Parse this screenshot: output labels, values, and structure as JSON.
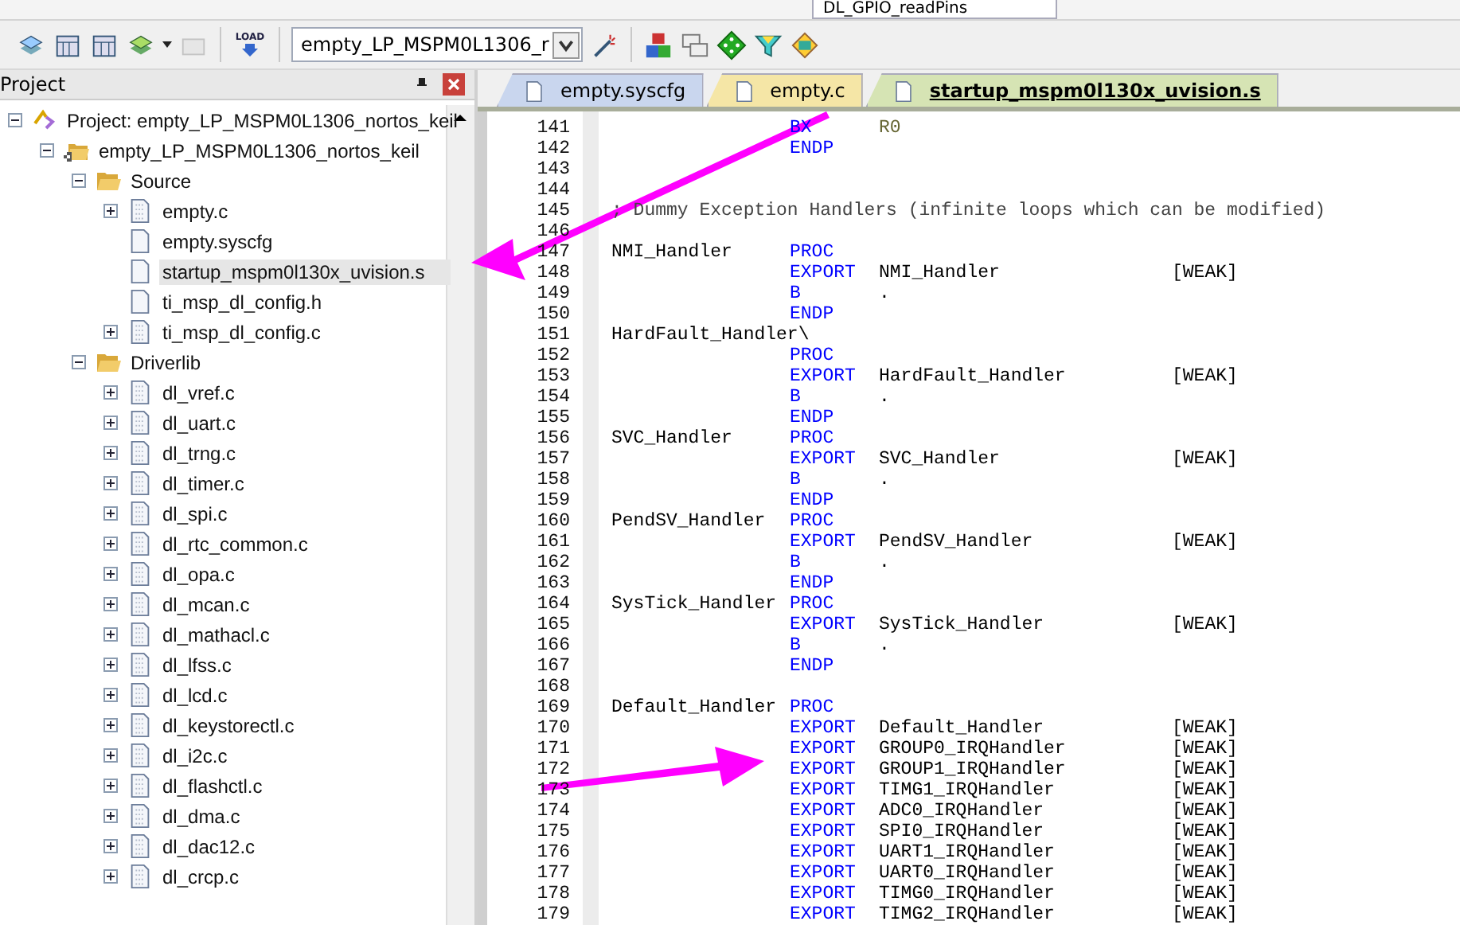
{
  "toolbar_top": {
    "function_dropdown": "DL_GPIO_readPins"
  },
  "toolbar": {
    "load_label": "LOAD",
    "target_dropdown": "empty_LP_MSPM0L1306_r"
  },
  "project_panel": {
    "title": "Project",
    "tree": [
      {
        "label": "Project: empty_LP_MSPM0L1306_nortos_keil",
        "kind": "project",
        "expanded": true,
        "selected": false,
        "children": [
          {
            "label": "empty_LP_MSPM0L1306_nortos_keil",
            "kind": "target",
            "expanded": true,
            "selected": false,
            "children": [
              {
                "label": "Source",
                "kind": "group",
                "expanded": true,
                "selected": false,
                "children": [
                  {
                    "label": "empty.c",
                    "kind": "file",
                    "expandable": true,
                    "selected": false
                  },
                  {
                    "label": "empty.syscfg",
                    "kind": "file",
                    "expandable": false,
                    "selected": false
                  },
                  {
                    "label": "startup_mspm0l130x_uvision.s",
                    "kind": "file",
                    "expandable": false,
                    "selected": true
                  },
                  {
                    "label": "ti_msp_dl_config.h",
                    "kind": "file",
                    "expandable": false,
                    "selected": false
                  },
                  {
                    "label": "ti_msp_dl_config.c",
                    "kind": "file",
                    "expandable": true,
                    "selected": false
                  }
                ]
              },
              {
                "label": "Driverlib",
                "kind": "group",
                "expanded": true,
                "selected": false,
                "children": [
                  {
                    "label": "dl_vref.c",
                    "kind": "file",
                    "expandable": true,
                    "selected": false
                  },
                  {
                    "label": "dl_uart.c",
                    "kind": "file",
                    "expandable": true,
                    "selected": false
                  },
                  {
                    "label": "dl_trng.c",
                    "kind": "file",
                    "expandable": true,
                    "selected": false
                  },
                  {
                    "label": "dl_timer.c",
                    "kind": "file",
                    "expandable": true,
                    "selected": false
                  },
                  {
                    "label": "dl_spi.c",
                    "kind": "file",
                    "expandable": true,
                    "selected": false
                  },
                  {
                    "label": "dl_rtc_common.c",
                    "kind": "file",
                    "expandable": true,
                    "selected": false
                  },
                  {
                    "label": "dl_opa.c",
                    "kind": "file",
                    "expandable": true,
                    "selected": false
                  },
                  {
                    "label": "dl_mcan.c",
                    "kind": "file",
                    "expandable": true,
                    "selected": false
                  },
                  {
                    "label": "dl_mathacl.c",
                    "kind": "file",
                    "expandable": true,
                    "selected": false
                  },
                  {
                    "label": "dl_lfss.c",
                    "kind": "file",
                    "expandable": true,
                    "selected": false
                  },
                  {
                    "label": "dl_lcd.c",
                    "kind": "file",
                    "expandable": true,
                    "selected": false
                  },
                  {
                    "label": "dl_keystorectl.c",
                    "kind": "file",
                    "expandable": true,
                    "selected": false
                  },
                  {
                    "label": "dl_i2c.c",
                    "kind": "file",
                    "expandable": true,
                    "selected": false
                  },
                  {
                    "label": "dl_flashctl.c",
                    "kind": "file",
                    "expandable": true,
                    "selected": false
                  },
                  {
                    "label": "dl_dma.c",
                    "kind": "file",
                    "expandable": true,
                    "selected": false
                  },
                  {
                    "label": "dl_dac12.c",
                    "kind": "file",
                    "expandable": true,
                    "selected": false
                  },
                  {
                    "label": "dl_crcp.c",
                    "kind": "file",
                    "expandable": true,
                    "selected": false
                  }
                ]
              }
            ]
          }
        ]
      }
    ]
  },
  "editor": {
    "tabs": [
      {
        "label": "empty.syscfg",
        "color": "#c9d6ee",
        "selected": false
      },
      {
        "label": "empty.c",
        "color": "#f5e6a6",
        "selected": false
      },
      {
        "label": "startup_mspm0l130x_uvision.s",
        "color": "#d6e4b4",
        "selected": true
      }
    ],
    "lines": [
      {
        "number": "141",
        "kind": "code",
        "op": "BX",
        "operand": "R0"
      },
      {
        "number": "142",
        "kind": "code",
        "op": "ENDP"
      },
      {
        "number": "143",
        "kind": "blank"
      },
      {
        "number": "144",
        "kind": "blank"
      },
      {
        "number": "145",
        "kind": "comment",
        "text": "; Dummy Exception Handlers (infinite loops which can be modified)"
      },
      {
        "number": "146",
        "kind": "blank"
      },
      {
        "number": "147",
        "kind": "code",
        "label": "NMI_Handler",
        "op": "PROC"
      },
      {
        "number": "148",
        "kind": "code",
        "op": "EXPORT",
        "operand": "NMI_Handler",
        "attr": "[WEAK]"
      },
      {
        "number": "149",
        "kind": "code",
        "op": "B",
        "operand": "."
      },
      {
        "number": "150",
        "kind": "code",
        "op": "ENDP"
      },
      {
        "number": "151",
        "kind": "code",
        "label": "HardFault_Handler\\"
      },
      {
        "number": "152",
        "kind": "code",
        "op": "PROC"
      },
      {
        "number": "153",
        "kind": "code",
        "op": "EXPORT",
        "operand": "HardFault_Handler",
        "attr": "[WEAK]"
      },
      {
        "number": "154",
        "kind": "code",
        "op": "B",
        "operand": "."
      },
      {
        "number": "155",
        "kind": "code",
        "op": "ENDP"
      },
      {
        "number": "156",
        "kind": "code",
        "label": "SVC_Handler",
        "op": "PROC"
      },
      {
        "number": "157",
        "kind": "code",
        "op": "EXPORT",
        "operand": "SVC_Handler",
        "attr": "[WEAK]"
      },
      {
        "number": "158",
        "kind": "code",
        "op": "B",
        "operand": "."
      },
      {
        "number": "159",
        "kind": "code",
        "op": "ENDP"
      },
      {
        "number": "160",
        "kind": "code",
        "label": "PendSV_Handler",
        "op": "PROC"
      },
      {
        "number": "161",
        "kind": "code",
        "op": "EXPORT",
        "operand": "PendSV_Handler",
        "attr": "[WEAK]"
      },
      {
        "number": "162",
        "kind": "code",
        "op": "B",
        "operand": "."
      },
      {
        "number": "163",
        "kind": "code",
        "op": "ENDP"
      },
      {
        "number": "164",
        "kind": "code",
        "label": "SysTick_Handler",
        "op": "PROC"
      },
      {
        "number": "165",
        "kind": "code",
        "op": "EXPORT",
        "operand": "SysTick_Handler",
        "attr": "[WEAK]"
      },
      {
        "number": "166",
        "kind": "code",
        "op": "B",
        "operand": "."
      },
      {
        "number": "167",
        "kind": "code",
        "op": "ENDP"
      },
      {
        "number": "168",
        "kind": "blank"
      },
      {
        "number": "169",
        "kind": "code",
        "label": "Default_Handler",
        "op": "PROC"
      },
      {
        "number": "170",
        "kind": "code",
        "op": "EXPORT",
        "operand": "Default_Handler",
        "attr": "[WEAK]"
      },
      {
        "number": "171",
        "kind": "code",
        "op": "EXPORT",
        "operand": "GROUP0_IRQHandler",
        "attr": "[WEAK]"
      },
      {
        "number": "172",
        "kind": "code",
        "op": "EXPORT",
        "operand": "GROUP1_IRQHandler",
        "attr": "[WEAK]"
      },
      {
        "number": "173",
        "kind": "code",
        "op": "EXPORT",
        "operand": "TIMG1_IRQHandler",
        "attr": "[WEAK]"
      },
      {
        "number": "174",
        "kind": "code",
        "op": "EXPORT",
        "operand": "ADC0_IRQHandler",
        "attr": "[WEAK]"
      },
      {
        "number": "175",
        "kind": "code",
        "op": "EXPORT",
        "operand": "SPI0_IRQHandler",
        "attr": "[WEAK]"
      },
      {
        "number": "176",
        "kind": "code",
        "op": "EXPORT",
        "operand": "UART1_IRQHandler",
        "attr": "[WEAK]"
      },
      {
        "number": "177",
        "kind": "code",
        "op": "EXPORT",
        "operand": "UART0_IRQHandler",
        "attr": "[WEAK]"
      },
      {
        "number": "178",
        "kind": "code",
        "op": "EXPORT",
        "operand": "TIMG0_IRQHandler",
        "attr": "[WEAK]"
      },
      {
        "number": "179",
        "kind": "code",
        "op": "EXPORT",
        "operand": "TIMG2_IRQHandler",
        "attr": "[WEAK]"
      }
    ]
  }
}
